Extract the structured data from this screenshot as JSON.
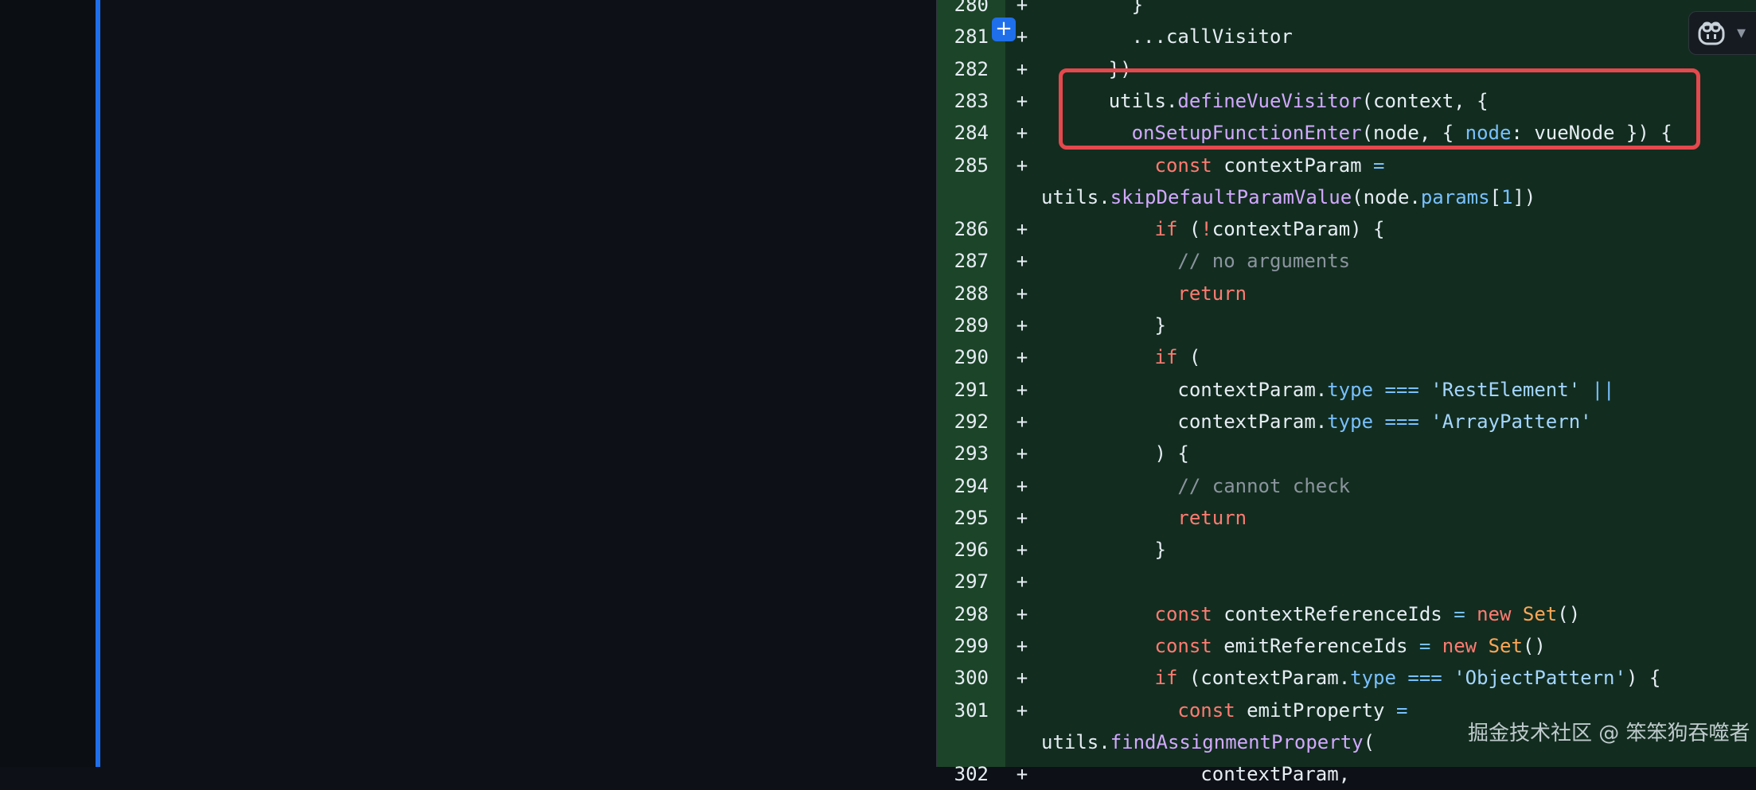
{
  "diff": {
    "lines": [
      {
        "num": "280",
        "marker": "+",
        "tokens": [
          [
            "",
            "        }"
          ]
        ]
      },
      {
        "num": "281",
        "marker": "+",
        "tokens": [
          [
            "",
            "        ...callVisitor"
          ]
        ]
      },
      {
        "num": "282",
        "marker": "+",
        "tokens": [
          [
            "",
            "      })"
          ]
        ]
      },
      {
        "num": "283",
        "marker": "+",
        "tokens": [
          [
            "",
            "      utils."
          ],
          [
            "f",
            "defineVueVisitor"
          ],
          [
            "",
            "(context, {"
          ]
        ]
      },
      {
        "num": "284",
        "marker": "+",
        "tokens": [
          [
            "",
            "        "
          ],
          [
            "f",
            "onSetupFunctionEnter"
          ],
          [
            "",
            "(node, { "
          ],
          [
            "p",
            "node"
          ],
          [
            "",
            ": vueNode }) {"
          ]
        ]
      },
      {
        "num": "285",
        "marker": "+",
        "tokens": [
          [
            "",
            "          "
          ],
          [
            "k",
            "const"
          ],
          [
            "",
            " contextParam "
          ],
          [
            "p",
            "="
          ]
        ]
      },
      {
        "num": "",
        "marker": "",
        "wrap": true,
        "tokens": [
          [
            "",
            "utils."
          ],
          [
            "f",
            "skipDefaultParamValue"
          ],
          [
            "",
            "(node."
          ],
          [
            "p",
            "params"
          ],
          [
            "",
            "["
          ],
          [
            "p",
            "1"
          ],
          [
            "",
            "])"
          ]
        ]
      },
      {
        "num": "286",
        "marker": "+",
        "tokens": [
          [
            "",
            "          "
          ],
          [
            "k",
            "if"
          ],
          [
            "",
            " ("
          ],
          [
            "k",
            "!"
          ],
          [
            "",
            "contextParam) {"
          ]
        ]
      },
      {
        "num": "287",
        "marker": "+",
        "tokens": [
          [
            "",
            "            "
          ],
          [
            "c",
            "// no arguments"
          ]
        ]
      },
      {
        "num": "288",
        "marker": "+",
        "tokens": [
          [
            "",
            "            "
          ],
          [
            "k",
            "return"
          ]
        ]
      },
      {
        "num": "289",
        "marker": "+",
        "tokens": [
          [
            "",
            "          }"
          ]
        ]
      },
      {
        "num": "290",
        "marker": "+",
        "tokens": [
          [
            "",
            "          "
          ],
          [
            "k",
            "if"
          ],
          [
            "",
            " ("
          ]
        ]
      },
      {
        "num": "291",
        "marker": "+",
        "tokens": [
          [
            "",
            "            contextParam."
          ],
          [
            "p",
            "type"
          ],
          [
            "",
            " "
          ],
          [
            "p",
            "==="
          ],
          [
            "",
            " "
          ],
          [
            "s",
            "'RestElement'"
          ],
          [
            "",
            " "
          ],
          [
            "p",
            "||"
          ]
        ]
      },
      {
        "num": "292",
        "marker": "+",
        "tokens": [
          [
            "",
            "            contextParam."
          ],
          [
            "p",
            "type"
          ],
          [
            "",
            " "
          ],
          [
            "p",
            "==="
          ],
          [
            "",
            " "
          ],
          [
            "s",
            "'ArrayPattern'"
          ]
        ]
      },
      {
        "num": "293",
        "marker": "+",
        "tokens": [
          [
            "",
            "          ) {"
          ]
        ]
      },
      {
        "num": "294",
        "marker": "+",
        "tokens": [
          [
            "",
            "            "
          ],
          [
            "c",
            "// cannot check"
          ]
        ]
      },
      {
        "num": "295",
        "marker": "+",
        "tokens": [
          [
            "",
            "            "
          ],
          [
            "k",
            "return"
          ]
        ]
      },
      {
        "num": "296",
        "marker": "+",
        "tokens": [
          [
            "",
            "          }"
          ]
        ]
      },
      {
        "num": "297",
        "marker": "+",
        "tokens": []
      },
      {
        "num": "298",
        "marker": "+",
        "tokens": [
          [
            "",
            "          "
          ],
          [
            "k",
            "const"
          ],
          [
            "",
            " contextReferenceIds "
          ],
          [
            "p",
            "="
          ],
          [
            "",
            " "
          ],
          [
            "k",
            "new"
          ],
          [
            "",
            " "
          ],
          [
            "cls",
            "Set"
          ],
          [
            "",
            "()"
          ]
        ]
      },
      {
        "num": "299",
        "marker": "+",
        "tokens": [
          [
            "",
            "          "
          ],
          [
            "k",
            "const"
          ],
          [
            "",
            " emitReferenceIds "
          ],
          [
            "p",
            "="
          ],
          [
            "",
            " "
          ],
          [
            "k",
            "new"
          ],
          [
            "",
            " "
          ],
          [
            "cls",
            "Set"
          ],
          [
            "",
            "()"
          ]
        ]
      },
      {
        "num": "300",
        "marker": "+",
        "tokens": [
          [
            "",
            "          "
          ],
          [
            "k",
            "if"
          ],
          [
            "",
            " (contextParam."
          ],
          [
            "p",
            "type"
          ],
          [
            "",
            " "
          ],
          [
            "p",
            "==="
          ],
          [
            "",
            " "
          ],
          [
            "s",
            "'ObjectPattern'"
          ],
          [
            "",
            ") {"
          ]
        ]
      },
      {
        "num": "301",
        "marker": "+",
        "tokens": [
          [
            "",
            "            "
          ],
          [
            "k",
            "const"
          ],
          [
            "",
            " emitProperty "
          ],
          [
            "p",
            "="
          ]
        ]
      },
      {
        "num": "",
        "marker": "",
        "wrap": true,
        "tokens": [
          [
            "",
            "utils."
          ],
          [
            "f",
            "findAssignmentProperty"
          ],
          [
            "",
            "("
          ]
        ]
      },
      {
        "num": "302",
        "marker": "+",
        "tokens": [
          [
            "",
            "              contextParam,"
          ]
        ]
      }
    ]
  },
  "add_line_button": {
    "label": "+"
  },
  "copilot": {
    "icon": "copilot-icon",
    "menu_icon": "chevron-down-icon",
    "chevron": "▾"
  },
  "watermark": {
    "text": "掘金技术社区 @ 笨笨狗吞噬者"
  }
}
